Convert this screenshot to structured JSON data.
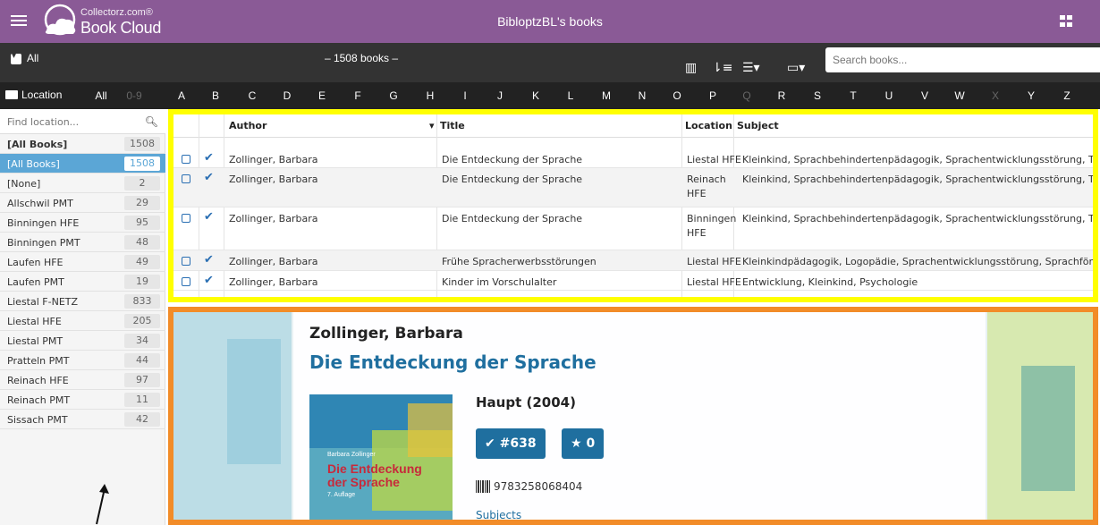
{
  "header": {
    "brand_top": "Collectorz.com®",
    "brand_main": "Book Cloud",
    "title": "BibloptzBL's books",
    "color": "#8a5a96"
  },
  "toolbar": {
    "filter_label": "All",
    "count_text": "– 1508 books –",
    "search_placeholder": "Search books..."
  },
  "alphabet": {
    "location_label": "Location",
    "letters": [
      {
        "t": "All",
        "dim": false
      },
      {
        "t": "0-9",
        "dim": true
      },
      {
        "t": "A",
        "dim": false
      },
      {
        "t": "B",
        "dim": false
      },
      {
        "t": "C",
        "dim": false
      },
      {
        "t": "D",
        "dim": false
      },
      {
        "t": "E",
        "dim": false
      },
      {
        "t": "F",
        "dim": false
      },
      {
        "t": "G",
        "dim": false
      },
      {
        "t": "H",
        "dim": false
      },
      {
        "t": "I",
        "dim": false
      },
      {
        "t": "J",
        "dim": false
      },
      {
        "t": "K",
        "dim": false
      },
      {
        "t": "L",
        "dim": false
      },
      {
        "t": "M",
        "dim": false
      },
      {
        "t": "N",
        "dim": false
      },
      {
        "t": "O",
        "dim": false
      },
      {
        "t": "P",
        "dim": false
      },
      {
        "t": "Q",
        "dim": true
      },
      {
        "t": "R",
        "dim": false
      },
      {
        "t": "S",
        "dim": false
      },
      {
        "t": "T",
        "dim": false
      },
      {
        "t": "U",
        "dim": false
      },
      {
        "t": "V",
        "dim": false
      },
      {
        "t": "W",
        "dim": false
      },
      {
        "t": "X",
        "dim": true
      },
      {
        "t": "Y",
        "dim": false
      },
      {
        "t": "Z",
        "dim": false
      }
    ]
  },
  "sidebar": {
    "find_placeholder": "Find location...",
    "locations": [
      {
        "name": "[All Books]",
        "count": "1508",
        "bold": true,
        "active": false
      },
      {
        "name": "[All Books]",
        "count": "1508",
        "bold": false,
        "active": true
      },
      {
        "name": "[None]",
        "count": "2",
        "bold": false,
        "active": false
      },
      {
        "name": "Allschwil PMT",
        "count": "29",
        "bold": false,
        "active": false
      },
      {
        "name": "Binningen HFE",
        "count": "95",
        "bold": false,
        "active": false
      },
      {
        "name": "Binningen PMT",
        "count": "48",
        "bold": false,
        "active": false
      },
      {
        "name": "Laufen HFE",
        "count": "49",
        "bold": false,
        "active": false
      },
      {
        "name": "Laufen PMT",
        "count": "19",
        "bold": false,
        "active": false
      },
      {
        "name": "Liestal F-NETZ",
        "count": "833",
        "bold": false,
        "active": false
      },
      {
        "name": "Liestal HFE",
        "count": "205",
        "bold": false,
        "active": false
      },
      {
        "name": "Liestal PMT",
        "count": "34",
        "bold": false,
        "active": false
      },
      {
        "name": "Pratteln PMT",
        "count": "44",
        "bold": false,
        "active": false
      },
      {
        "name": "Reinach HFE",
        "count": "97",
        "bold": false,
        "active": false
      },
      {
        "name": "Reinach PMT",
        "count": "11",
        "bold": false,
        "active": false
      },
      {
        "name": "Sissach PMT",
        "count": "42",
        "bold": false,
        "active": false
      }
    ]
  },
  "table": {
    "columns": {
      "author": "Author",
      "title": "Title",
      "location": "Location",
      "subject": "Subject"
    },
    "rows": [
      {
        "author": "Zollinger, Barbara",
        "title": "Die Entdeckung der Sprache",
        "loc1": "Liestal HFE",
        "loc2": "",
        "subject": "Kleinkind, Sprachbehindertenpädagogik, Sprachentwicklungsstörung, Therap"
      },
      {
        "author": "Zollinger, Barbara",
        "title": "Die Entdeckung der Sprache",
        "loc1": "Reinach",
        "loc2": "HFE",
        "subject": "Kleinkind, Sprachbehindertenpädagogik, Sprachentwicklungsstörung, Therap"
      },
      {
        "author": "Zollinger, Barbara",
        "title": "Die Entdeckung der Sprache",
        "loc1": "Binningen",
        "loc2": "HFE",
        "subject": "Kleinkind, Sprachbehindertenpädagogik, Sprachentwicklungsstörung, Therap"
      },
      {
        "author": "Zollinger, Barbara",
        "title": "Frühe Spracherwerbsstörungen",
        "loc1": "Liestal HFE",
        "loc2": "",
        "subject": "Kleinkindpädagogik, Logopädie, Sprachentwicklungsstörung, Sprachförderun"
      },
      {
        "author": "Zollinger, Barbara",
        "title": "Kinder im Vorschulalter",
        "loc1": "Liestal HFE",
        "loc2": "",
        "subject": "Entwicklung, Kleinkind, Psychologie"
      }
    ]
  },
  "detail": {
    "author": "Zollinger, Barbara",
    "title": "Die Entdeckung der Sprache",
    "publisher_year": "Haupt (2004)",
    "index_label": "#638",
    "rating_label": "0",
    "isbn": "9783258068404",
    "subjects_label": "Subjects",
    "cover": {
      "author": "Barbara Zollinger",
      "title_line1": "Die Entdeckung",
      "title_line2": "der Sprache",
      "edition": "7. Auflage"
    }
  },
  "colors": {
    "accent": "#1f6f9f",
    "highlight_table": "#ffff00",
    "highlight_detail": "#f28c28",
    "sidebar_active": "#5ba6d6"
  }
}
